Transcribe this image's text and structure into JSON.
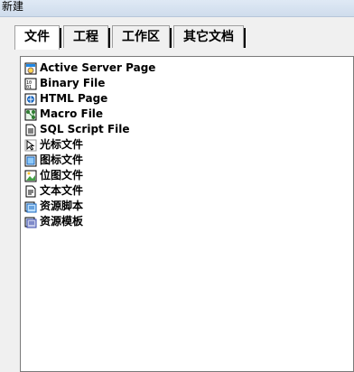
{
  "window": {
    "title": "新建"
  },
  "tabs": [
    {
      "label": "文件",
      "active": true
    },
    {
      "label": "工程",
      "active": false
    },
    {
      "label": "工作区",
      "active": false
    },
    {
      "label": "其它文档",
      "active": false
    }
  ],
  "items": [
    {
      "label": "Active Server Page",
      "icon": "asp-file-icon"
    },
    {
      "label": "Binary File",
      "icon": "binary-file-icon"
    },
    {
      "label": "HTML Page",
      "icon": "html-page-icon"
    },
    {
      "label": "Macro File",
      "icon": "macro-file-icon"
    },
    {
      "label": "SQL Script File",
      "icon": "sql-script-icon"
    },
    {
      "label": "光标文件",
      "icon": "cursor-file-icon"
    },
    {
      "label": "图标文件",
      "icon": "icon-file-icon"
    },
    {
      "label": "位图文件",
      "icon": "bitmap-file-icon"
    },
    {
      "label": "文本文件",
      "icon": "text-file-icon"
    },
    {
      "label": "资源脚本",
      "icon": "resource-script-icon"
    },
    {
      "label": "资源模板",
      "icon": "resource-template-icon"
    }
  ]
}
